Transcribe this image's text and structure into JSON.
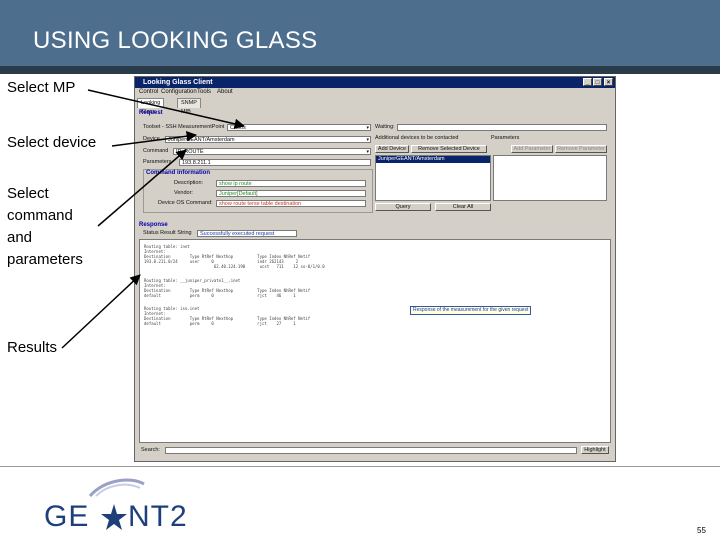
{
  "slide": {
    "title": "USING LOOKING GLASS",
    "page_number": "55",
    "logo_text": "GÉANT2",
    "labels": {
      "select_mp": "Select MP",
      "select_device": "Select device",
      "select_command_lines": [
        "Select",
        "command",
        "and",
        "parameters"
      ],
      "results": "Results"
    }
  },
  "window": {
    "title": "Looking Glass Client",
    "menu": [
      "Control",
      "Configuration",
      "Tools",
      "About"
    ],
    "tabs": [
      "Looking Glass",
      "SNMP MIB"
    ],
    "request": {
      "section_title": "Request",
      "mp_label": "Toolset - SSH MeasurementPoint",
      "mp_value": "Choos",
      "device_label": "Device",
      "device_value": "JuniperGEANT/Amsterdam",
      "command_label": "Command",
      "command_value": "IP_ROUTE",
      "parameters_label": "Parameters",
      "parameters_value": "193.8.211.1",
      "waiting_label": "Waiting:",
      "available_devices_label": "Additional devices to be contacted",
      "parameters_col_label": "Parameters",
      "add_device": "Add Device",
      "remove_device": "Remove Selected Device",
      "add_parameter": "Add Parameter",
      "remove_parameter": "Remove Parameter",
      "selected_device": "JuniperGEANT/Amsterdam",
      "query_button": "Query",
      "clear_button": "Clear All"
    },
    "command_info": {
      "title": "Command information",
      "description_label": "Description:",
      "description_value": "show ip route",
      "vendor_label": "Vendor:",
      "vendor_value": "Juniper[Default]",
      "os_label": "Device OS Command:",
      "os_value": "show route terse table destination"
    },
    "response": {
      "section_title": "Response",
      "status_label": "Status Result String",
      "status_value": "Successfully executed request",
      "lines": [
        "Routing table: inet",
        "Internet:",
        "Destination        Type RtRef Nexthop          Type Index NhRef Netif",
        "193.8.211.0/24     user     0                  indr 262143     2",
        "                             62.40.124.190      ucst   711    12 so-0/1/0.0",
        "",
        "Routing table: __juniper_private1__.inet",
        "Internet:",
        "Destination        Type RtRef Nexthop          Type Index NhRef Netif",
        "default            perm     0                  rjct    46     1",
        "",
        "Routing table: iso.inet",
        "Internet:",
        "Destination        Type RtRef Nexthop          Type Index NhRef Netif",
        "default            perm     0                  rjct    27     1"
      ],
      "tooltip": "Response of the measurement for the given request",
      "search_label": "Search:",
      "highlight_button": "Highlight"
    }
  }
}
